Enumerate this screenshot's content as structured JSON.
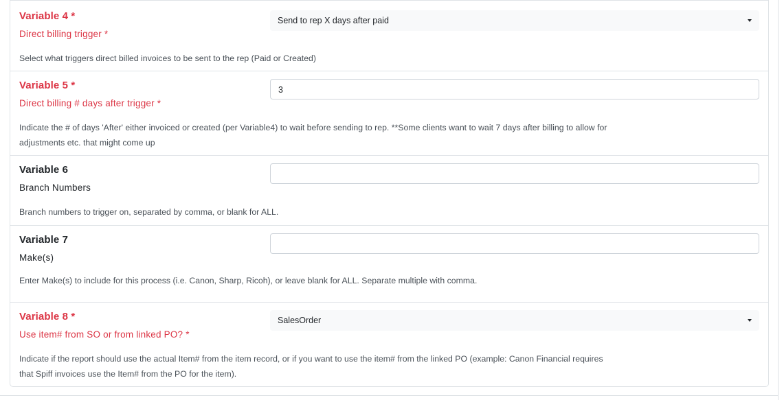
{
  "variables": [
    {
      "title": "Variable 4 *",
      "subtitle": "Direct billing trigger *",
      "help": "Select what triggers direct billed invoices to be sent to the rep (Paid or Created)",
      "control": "select",
      "value": "Send to rep X days after paid",
      "required": true
    },
    {
      "title": "Variable 5 *",
      "subtitle": "Direct billing # days after trigger *",
      "help_line1": "Indicate the # of days 'After' either invoiced or created (per Variable4) to wait before sending to rep. **Some clients want to wait 7 days after billing to allow for",
      "help_line2": "adjustments etc. that might come up",
      "control": "input",
      "value": "3",
      "required": true
    },
    {
      "title": "Variable 6",
      "subtitle": "Branch Numbers",
      "help": "Branch numbers to trigger on, separated by comma, or blank for ALL.",
      "control": "input",
      "value": "",
      "required": false
    },
    {
      "title": "Variable 7",
      "subtitle": "Make(s)",
      "help": "Enter Make(s) to include for this process (i.e. Canon, Sharp, Ricoh), or leave blank for ALL. Separate multiple with comma.",
      "control": "input",
      "value": "",
      "required": false
    },
    {
      "title": "Variable 8 *",
      "subtitle": "Use item# from SO or from linked PO? *",
      "help_line1": "Indicate if the report should use the actual Item# from the item record, or if you want to use the item# from the linked PO (example: Canon Financial requires",
      "help_line2": "that Spiff invoices use the Item# from the PO for the item).",
      "control": "select",
      "value": "SalesOrder",
      "required": true
    }
  ],
  "colors": {
    "required": "#dc3545",
    "text": "#212529",
    "help": "#495057",
    "border": "#dee2e6",
    "select_bg": "#f8f9fa"
  },
  "icons": {
    "dropdown": "caret-down-icon"
  }
}
